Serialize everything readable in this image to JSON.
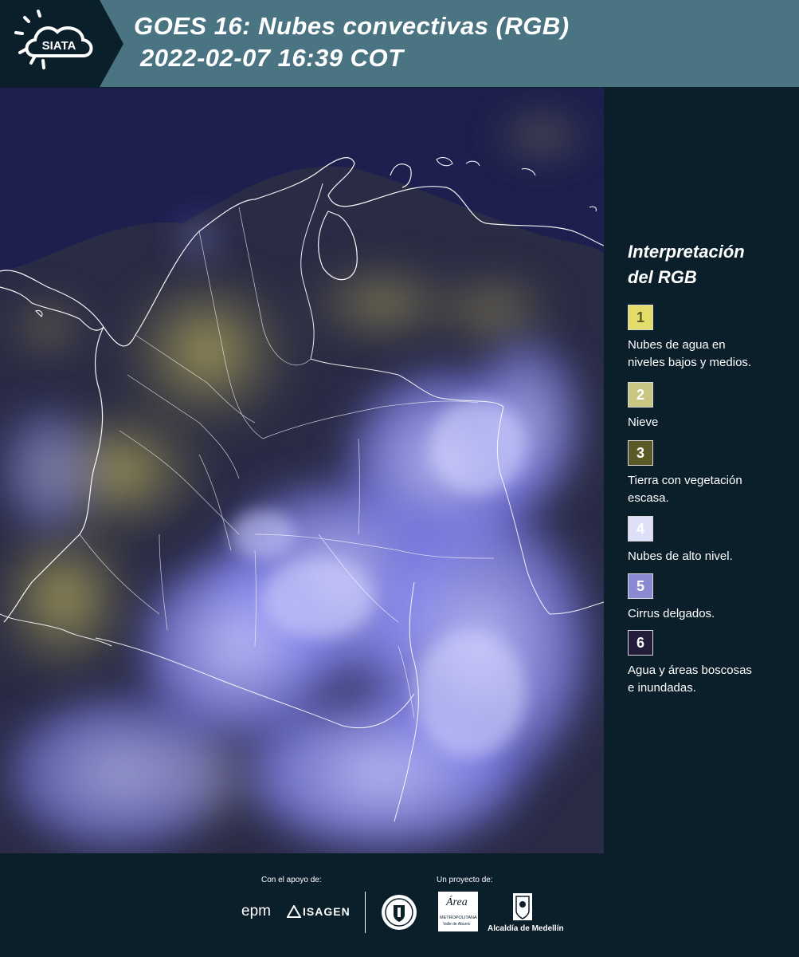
{
  "header": {
    "logo_text": "SIATA",
    "title_line1": "GOES 16: Nubes convectivas (RGB)",
    "title_line2": "2022-02-07 16:39 COT"
  },
  "legend": {
    "title_line1": "Interpretación",
    "title_line2": "del RGB",
    "items": [
      {
        "number": "1",
        "color": "#e2dd6a",
        "number_color": "#5a5a20",
        "lines": [
          "Nubes de agua en",
          "niveles bajos y medios."
        ]
      },
      {
        "number": "2",
        "color": "#c9c682",
        "number_color": "#ffffff",
        "lines": [
          "Nieve"
        ]
      },
      {
        "number": "3",
        "color": "#5b5a26",
        "number_color": "#ffffff",
        "lines": [
          "Tierra con vegetación",
          "escasa."
        ]
      },
      {
        "number": "4",
        "color": "#dedff8",
        "number_color": "#ffffff",
        "lines": [
          "Nubes de alto nivel."
        ]
      },
      {
        "number": "5",
        "color": "#8a8ad2",
        "number_color": "#ffffff",
        "lines": [
          "Cirrus delgados."
        ]
      },
      {
        "number": "6",
        "color": "#211d3a",
        "number_color": "#ffffff",
        "lines": [
          "Agua y áreas boscosas",
          "e inundadas."
        ]
      }
    ]
  },
  "footer": {
    "support_label": "Con el apoyo de:",
    "project_label": "Un proyecto de:",
    "epm": "epm",
    "isagen": "ISAGEN",
    "area_metro": "Área",
    "area_metro_sub": "METROPOLITANA",
    "area_metro_sub2": "Valle de Aburrá",
    "alcaldia": "Alcaldía de Medellín"
  },
  "colors": {
    "header_bg": "#4b7482",
    "logo_bg": "#0b1f2b",
    "page_bg": "#0b1f2b",
    "ocean": "#1b1d4a",
    "high_cloud": "#9a9cf2",
    "low_cloud": "#b6ad5c",
    "border_line": "#ffffff"
  }
}
